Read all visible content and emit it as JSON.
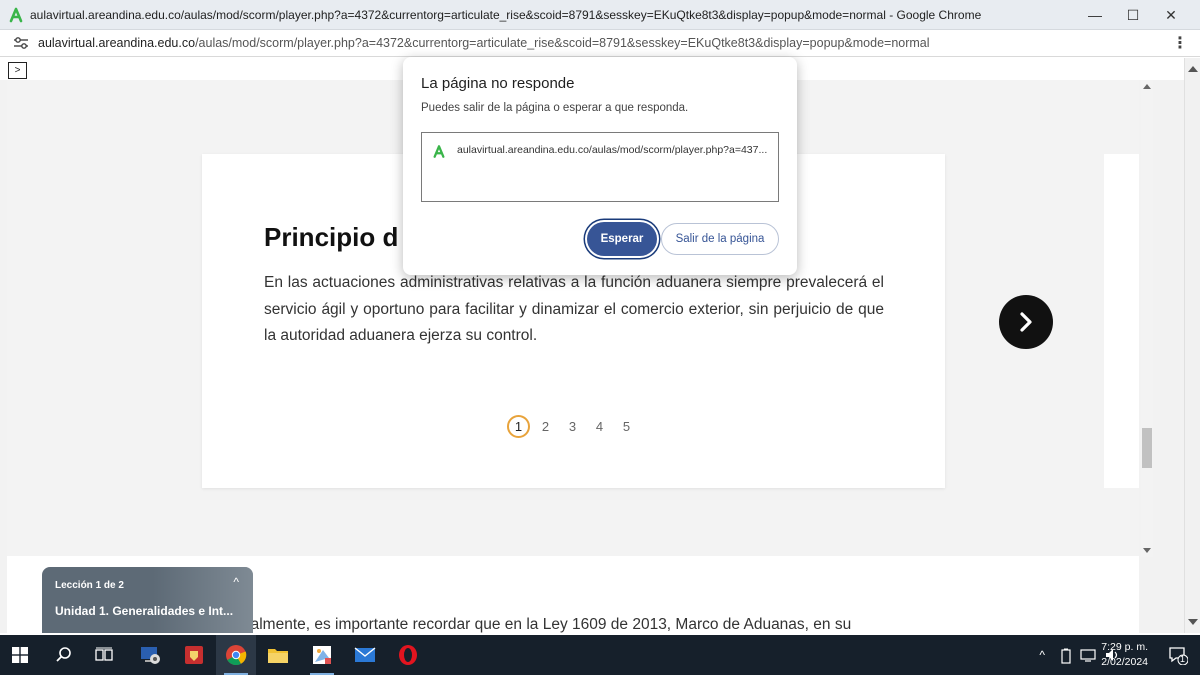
{
  "window": {
    "title": "aulavirtual.areandina.edu.co/aulas/mod/scorm/player.php?a=4372&currentorg=articulate_rise&scoid=8791&sesskey=EKuQtke8t3&display=popup&mode=normal - Google Chrome",
    "controls": {
      "minimize": "—",
      "maximize": "☐",
      "close": "✕"
    }
  },
  "address_bar": {
    "host": "aulavirtual.areandina.edu.co",
    "path": "/aulas/mod/scorm/player.php?a=4372&currentorg=articulate_rise&scoid=8791&sesskey=EKuQtke8t3&display=popup&mode=normal",
    "more_icon": "⋮"
  },
  "page": {
    "toggle_label": ">",
    "card": {
      "heading": "Principio d",
      "body": "En las actuaciones administrativas relativas a la función aduanera siempre prevalecerá el servicio ágil y oportuno para facilitar y dinamizar el comercio exterior, sin perjuicio de que la autoridad aduanera ejerza su control.",
      "pages": [
        "1",
        "2",
        "3",
        "4",
        "5"
      ],
      "active_page": "1"
    },
    "bottom_text": "nalmente, es importante recordar que en la Ley 1609 de 2013, Marco de Aduanas, en su",
    "lesson": {
      "counter": "Lección 1 de 2",
      "title": "Unidad 1. Generalidades e Int...",
      "chevron": "^"
    }
  },
  "dialog": {
    "title": "La página no responde",
    "message": "Puedes salir de la página o esperar a que responda.",
    "url": "aulavirtual.areandina.edu.co/aulas/mod/scorm/player.php?a=437...",
    "wait_label": "Esperar",
    "leave_label": "Salir de la página"
  },
  "taskbar": {
    "time": "7:29 p. m.",
    "date": "2/02/2024",
    "notifications": "1",
    "caret": "^"
  },
  "colors": {
    "accent": "#375596",
    "pager_active": "#e8a33b",
    "taskbar": "#16202b",
    "favicon": "#3ab54a"
  }
}
